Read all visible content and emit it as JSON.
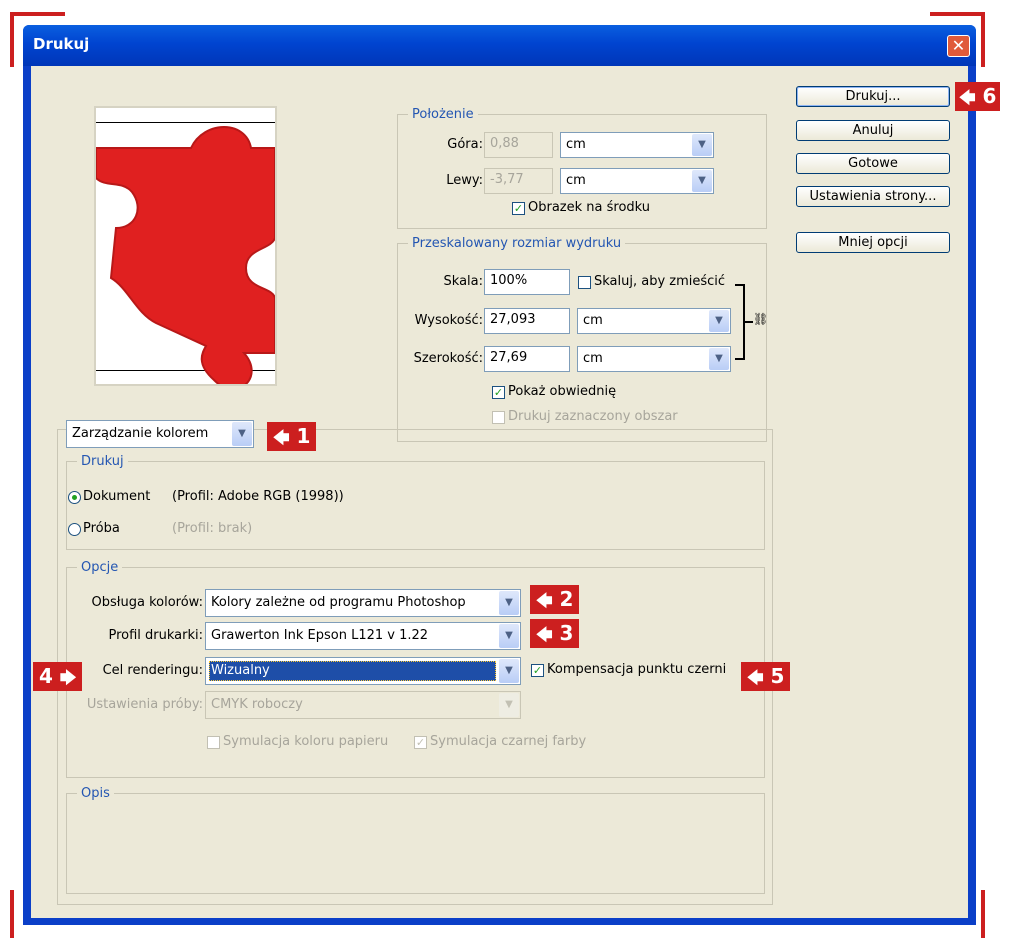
{
  "window": {
    "title": "Drukuj",
    "close_glyph": "✕"
  },
  "position": {
    "legend": "Położenie",
    "top_label": "Góra:",
    "top_value": "0,88",
    "top_unit": "cm",
    "left_label": "Lewy:",
    "left_value": "-3,77",
    "left_unit": "cm",
    "center_label": "Obrazek na środku",
    "center_checked": true
  },
  "scaled": {
    "legend": "Przeskalowany rozmiar wydruku",
    "scale_label": "Skala:",
    "scale_value": "100%",
    "fit_label": "Skaluj, aby zmieścić",
    "height_label": "Wysokość:",
    "height_value": "27,093",
    "height_unit": "cm",
    "width_label": "Szerokość:",
    "width_value": "27,69",
    "width_unit": "cm",
    "show_bbox_label": "Pokaż obwiednię",
    "show_bbox_checked": true,
    "print_selection_label": "Drukuj zaznaczony obszar"
  },
  "buttons": {
    "print": "Drukuj...",
    "cancel": "Anuluj",
    "done": "Gotowe",
    "page_setup": "Ustawienia strony...",
    "fewer": "Mniej opcji"
  },
  "mode_select": "Zarządzanie kolorem",
  "print_group": {
    "legend": "Drukuj",
    "document_label": "Dokument",
    "document_profile": "(Profil: Adobe RGB (1998))",
    "proof_label": "Próba",
    "proof_profile": "(Profil: brak)"
  },
  "options": {
    "legend": "Opcje",
    "color_handling_label": "Obsługa kolorów:",
    "color_handling_value": "Kolory zależne od programu  Photoshop",
    "printer_profile_label": "Profil drukarki:",
    "printer_profile_value": "Grawerton Ink Epson L121 v 1.22",
    "rendering_label": "Cel renderingu:",
    "rendering_value": "Wizualny",
    "bpc_label": "Kompensacja punktu czerni",
    "bpc_checked": true,
    "proof_setup_label": "Ustawienia próby:",
    "proof_setup_value": "CMYK roboczy",
    "sim_paper_label": "Symulacja koloru papieru",
    "sim_ink_label": "Symulacja czarnej farby"
  },
  "description": {
    "legend": "Opis"
  },
  "annotations": {
    "n1": "1",
    "n2": "2",
    "n3": "3",
    "n4": "4",
    "n5": "5",
    "n6": "6",
    "arrow_left": "🡄",
    "arrow_right": "🡆",
    "color": "#cc1f1f"
  },
  "colors": {
    "accent": "#0044d0",
    "puzzle": "#e02020",
    "legend": "#2456b2"
  }
}
